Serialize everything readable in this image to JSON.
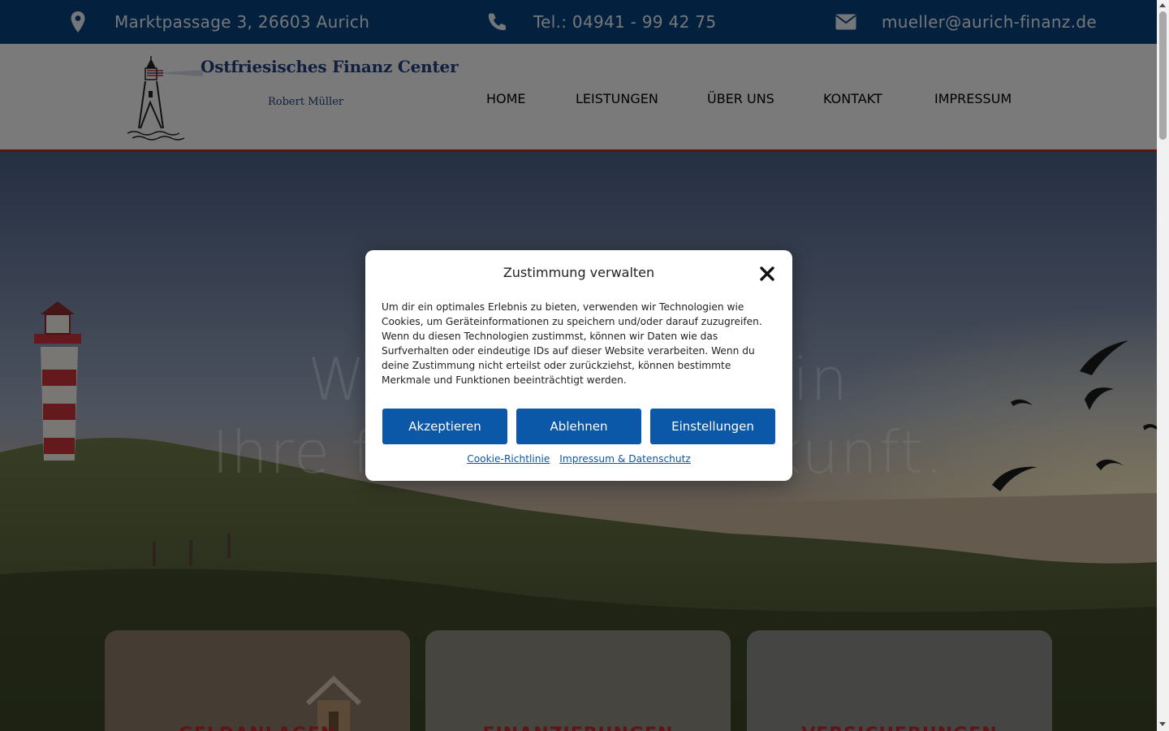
{
  "topbar": {
    "address": "Marktpassage 3, 26603 Aurich",
    "phone": "Tel.: 04941 - 99 42 75",
    "email": "mueller@aurich-finanz.de",
    "icons": [
      "map-pin-icon",
      "phone-icon",
      "envelope-icon"
    ]
  },
  "logo": {
    "title": "Ostfriesisches Finanz Center",
    "subtitle": "Robert Müller"
  },
  "nav": {
    "items": [
      "HOME",
      "LEISTUNGEN",
      "ÜBER UNS",
      "KONTAKT",
      "IMPRESSUM"
    ]
  },
  "hero": {
    "line1": "Wir investieren in",
    "line2": "Ihre finanzielle Zukunft."
  },
  "cards": [
    {
      "title": "GELDANLAGEN"
    },
    {
      "title": "FINANZIERUNGEN"
    },
    {
      "title": "VERSICHERUNGEN"
    }
  ],
  "modal": {
    "title": "Zustimmung verwalten",
    "text": "Um dir ein optimales Erlebnis zu bieten, verwenden wir Technologien wie Cookies, um Geräteinformationen zu speichern und/oder darauf zuzugreifen. Wenn du diesen Technologien zustimmst, können wir Daten wie das Surfverhalten oder eindeutige IDs auf dieser Website verarbeiten. Wenn du deine Zustimmung nicht erteilst oder zurückziehst, können bestimmte Merkmale und Funktionen beeinträchtigt werden.",
    "accept": "Akzeptieren",
    "deny": "Ablehnen",
    "settings": "Einstellungen",
    "link_cookie": "Cookie-Richtlinie",
    "link_impressum": "Impressum & Datenschutz"
  },
  "colors": {
    "topbar": "#06427c",
    "nav_text": "#0a3f72",
    "accent_red": "#c61f26",
    "button": "#0b57a8"
  }
}
